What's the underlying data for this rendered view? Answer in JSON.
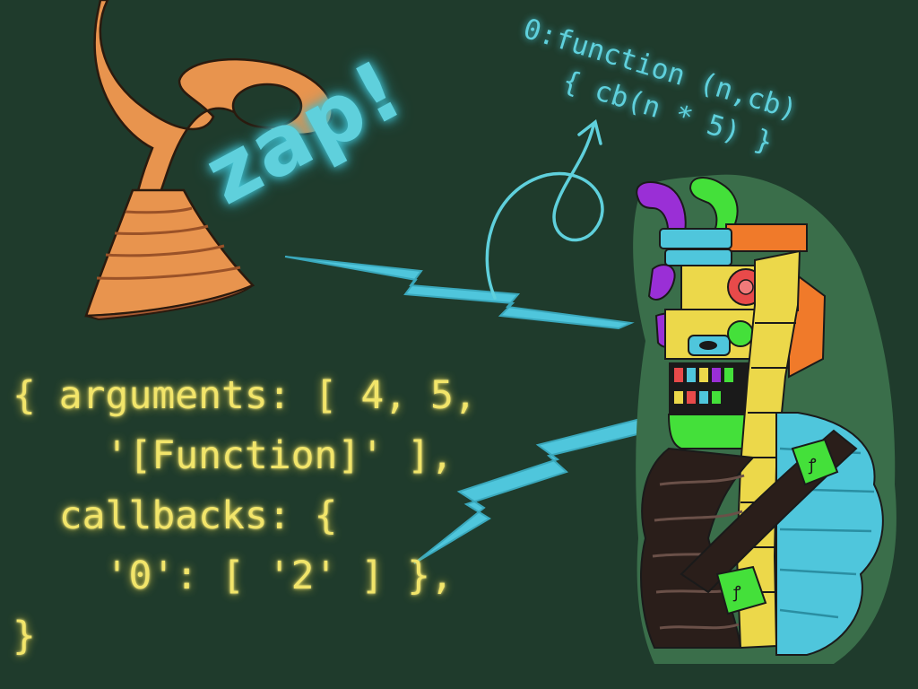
{
  "zap": {
    "text": "zap!"
  },
  "function_note": {
    "line1": "0:function (n,cb)",
    "line2": "{ cb(n * 5) }"
  },
  "code_block": {
    "lines": [
      "{ arguments: [ 4, 5,",
      "    '[Function]' ],",
      "  callbacks: {",
      "    '0': [ '2' ] },",
      "}"
    ]
  },
  "colors": {
    "background": "#1f3b2c",
    "code_text": "#f2e56a",
    "glow_cyan": "#5fd0dc",
    "horn": "#e8944e",
    "totem_yellow": "#ecd84a",
    "totem_green": "#44e03a",
    "totem_purple": "#9a2fd6",
    "totem_blue": "#4fc6dc"
  },
  "icons": [
    "telephone-horn-icon",
    "lightning-bolt-icon",
    "totem-creature-icon",
    "curly-arrow-icon"
  ]
}
